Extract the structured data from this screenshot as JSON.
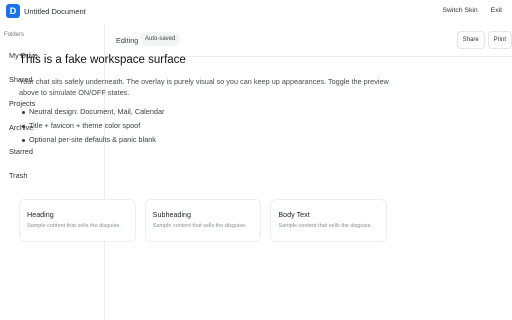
{
  "header": {
    "logo_letter": "D",
    "title": "Untitled Document",
    "actions": [
      "Switch Skin",
      "Exit"
    ]
  },
  "sidebar": {
    "heading": "Folders",
    "items": [
      "My Drive",
      "Shared",
      "Projects",
      "Archive",
      "Starred",
      "Trash"
    ]
  },
  "toolbar": {
    "mode": "Editing",
    "badge": "Auto-saved",
    "buttons": [
      "Share",
      "Print"
    ]
  },
  "content": {
    "title": "This is a fake workspace surface",
    "lead": "Your chat sits safely underneath. The overlay is purely visual so you can keep up appearances. Toggle the preview above to simulate ON/OFF states.",
    "bullets": [
      "Neutral design: Document, Mail, Calendar",
      "Title + favicon + theme color spoof",
      "Optional per-site defaults & panic blank"
    ]
  },
  "cards": [
    {
      "title": "Heading",
      "subtitle": "Sample content that sells the disguise."
    },
    {
      "title": "Subheading",
      "subtitle": "Sample content that sells the disguise."
    },
    {
      "title": "Body Text",
      "subtitle": "Sample content that sells the disguise."
    }
  ],
  "colors": {
    "accent": "#1a73e8",
    "border": "#eceef0",
    "badge_bg": "#f1f3f4"
  }
}
